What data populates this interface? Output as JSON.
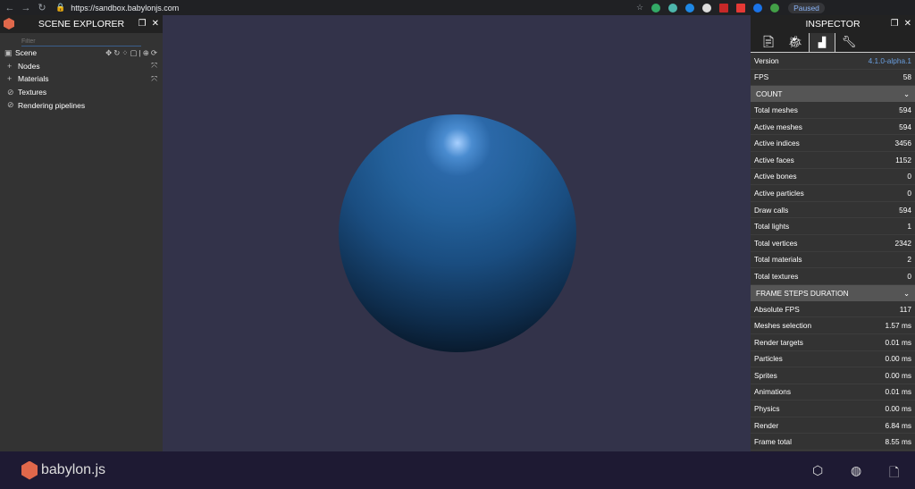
{
  "browser": {
    "url": "https://sandbox.babylonjs.com",
    "profile_status": "Paused"
  },
  "explorer": {
    "title": "SCENE EXPLORER",
    "filter_placeholder": "Filter",
    "scene_label": "Scene",
    "items": [
      {
        "label": "Nodes",
        "icon": "plus-icon"
      },
      {
        "label": "Materials",
        "icon": "plus-icon"
      },
      {
        "label": "Textures",
        "icon": "ban-icon"
      },
      {
        "label": "Rendering pipelines",
        "icon": "ban-icon"
      }
    ]
  },
  "inspector": {
    "title": "INSPECTOR",
    "tabs": [
      "properties",
      "debug",
      "statistics",
      "tools"
    ],
    "active_tab": "statistics",
    "version_label": "Version",
    "version": "4.1.0-alpha.1",
    "fps_label": "FPS",
    "fps": "58",
    "count": {
      "title": "COUNT",
      "rows": [
        {
          "label": "Total meshes",
          "value": "594"
        },
        {
          "label": "Active meshes",
          "value": "594"
        },
        {
          "label": "Active indices",
          "value": "3456"
        },
        {
          "label": "Active faces",
          "value": "1152"
        },
        {
          "label": "Active bones",
          "value": "0"
        },
        {
          "label": "Active particles",
          "value": "0"
        },
        {
          "label": "Draw calls",
          "value": "594"
        },
        {
          "label": "Total lights",
          "value": "1"
        },
        {
          "label": "Total vertices",
          "value": "2342"
        },
        {
          "label": "Total materials",
          "value": "2"
        },
        {
          "label": "Total textures",
          "value": "0"
        }
      ]
    },
    "frame": {
      "title": "FRAME STEPS DURATION",
      "rows": [
        {
          "label": "Absolute FPS",
          "value": "117"
        },
        {
          "label": "Meshes selection",
          "value": "1.57 ms"
        },
        {
          "label": "Render targets",
          "value": "0.01 ms"
        },
        {
          "label": "Particles",
          "value": "0.00 ms"
        },
        {
          "label": "Sprites",
          "value": "0.00 ms"
        },
        {
          "label": "Animations",
          "value": "0.01 ms"
        },
        {
          "label": "Physics",
          "value": "0.00 ms"
        },
        {
          "label": "Render",
          "value": "6.84 ms"
        },
        {
          "label": "Frame total",
          "value": "8.55 ms"
        }
      ]
    }
  },
  "footer": {
    "brand": "babylon.js"
  },
  "colors": {
    "accent": "#6a9fe0",
    "viewport": "#33334a",
    "footer": "#1e1a33"
  }
}
